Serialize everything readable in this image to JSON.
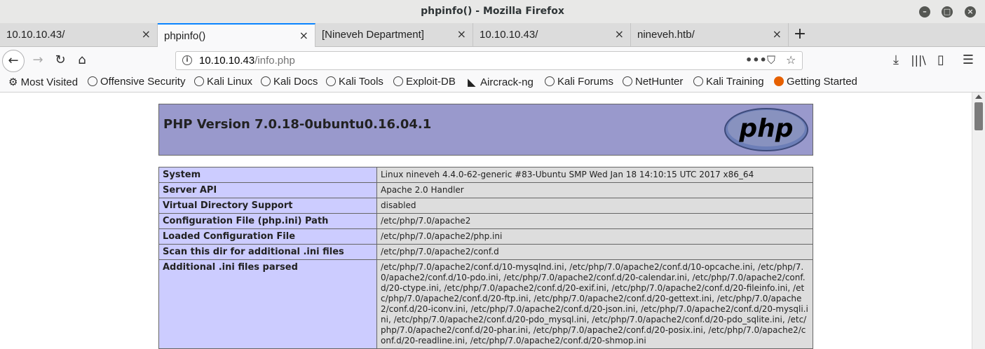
{
  "window": {
    "title": "phpinfo() - Mozilla Firefox"
  },
  "tabs": [
    {
      "label": "10.10.10.43/",
      "active": false
    },
    {
      "label": "phpinfo()",
      "active": true
    },
    {
      "label": "[Nineveh Department]",
      "active": false
    },
    {
      "label": "10.10.10.43/",
      "active": false
    },
    {
      "label": "nineveh.htb/",
      "active": false
    }
  ],
  "urlbar": {
    "host": "10.10.10.43",
    "path": "/info.php"
  },
  "bookmarks": [
    "Most Visited",
    "Offensive Security",
    "Kali Linux",
    "Kali Docs",
    "Kali Tools",
    "Exploit-DB",
    "Aircrack-ng",
    "Kali Forums",
    "NetHunter",
    "Kali Training",
    "Getting Started"
  ],
  "php": {
    "version_heading": "PHP Version 7.0.18-0ubuntu0.16.04.1",
    "logo_text": "php",
    "rows": [
      {
        "key": "System",
        "value": "Linux nineveh 4.4.0-62-generic #83-Ubuntu SMP Wed Jan 18 14:10:15 UTC 2017 x86_64"
      },
      {
        "key": "Server API",
        "value": "Apache 2.0 Handler"
      },
      {
        "key": "Virtual Directory Support",
        "value": "disabled"
      },
      {
        "key": "Configuration File (php.ini) Path",
        "value": "/etc/php/7.0/apache2"
      },
      {
        "key": "Loaded Configuration File",
        "value": "/etc/php/7.0/apache2/php.ini"
      },
      {
        "key": "Scan this dir for additional .ini files",
        "value": "/etc/php/7.0/apache2/conf.d"
      },
      {
        "key": "Additional .ini files parsed",
        "value": "/etc/php/7.0/apache2/conf.d/10-mysqlnd.ini, /etc/php/7.0/apache2/conf.d/10-opcache.ini, /etc/php/7.0/apache2/conf.d/10-pdo.ini, /etc/php/7.0/apache2/conf.d/20-calendar.ini, /etc/php/7.0/apache2/conf.d/20-ctype.ini, /etc/php/7.0/apache2/conf.d/20-exif.ini, /etc/php/7.0/apache2/conf.d/20-fileinfo.ini, /etc/php/7.0/apache2/conf.d/20-ftp.ini, /etc/php/7.0/apache2/conf.d/20-gettext.ini, /etc/php/7.0/apache2/conf.d/20-iconv.ini, /etc/php/7.0/apache2/conf.d/20-json.ini, /etc/php/7.0/apache2/conf.d/20-mysqli.ini, /etc/php/7.0/apache2/conf.d/20-pdo_mysql.ini, /etc/php/7.0/apache2/conf.d/20-pdo_sqlite.ini, /etc/php/7.0/apache2/conf.d/20-phar.ini, /etc/php/7.0/apache2/conf.d/20-posix.ini, /etc/php/7.0/apache2/conf.d/20-readline.ini, /etc/php/7.0/apache2/conf.d/20-shmop.ini"
      }
    ]
  }
}
